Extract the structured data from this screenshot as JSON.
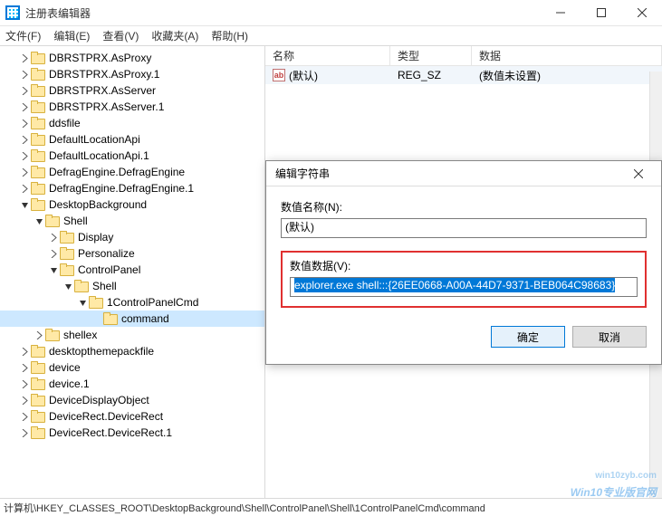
{
  "window": {
    "title": "注册表编辑器",
    "buttons": {
      "min": "minimize",
      "max": "maximize",
      "close": "close"
    }
  },
  "menu": {
    "file": "文件(F)",
    "edit": "编辑(E)",
    "view": "查看(V)",
    "favorites": "收藏夹(A)",
    "help": "帮助(H)"
  },
  "tree": [
    {
      "depth": 1,
      "expand": "closed",
      "label": "DBRSTPRX.AsProxy"
    },
    {
      "depth": 1,
      "expand": "closed",
      "label": "DBRSTPRX.AsProxy.1"
    },
    {
      "depth": 1,
      "expand": "closed",
      "label": "DBRSTPRX.AsServer"
    },
    {
      "depth": 1,
      "expand": "closed",
      "label": "DBRSTPRX.AsServer.1"
    },
    {
      "depth": 1,
      "expand": "closed",
      "label": "ddsfile"
    },
    {
      "depth": 1,
      "expand": "closed",
      "label": "DefaultLocationApi"
    },
    {
      "depth": 1,
      "expand": "closed",
      "label": "DefaultLocationApi.1"
    },
    {
      "depth": 1,
      "expand": "closed",
      "label": "DefragEngine.DefragEngine"
    },
    {
      "depth": 1,
      "expand": "closed",
      "label": "DefragEngine.DefragEngine.1"
    },
    {
      "depth": 1,
      "expand": "open",
      "label": "DesktopBackground"
    },
    {
      "depth": 2,
      "expand": "open",
      "label": "Shell"
    },
    {
      "depth": 3,
      "expand": "closed",
      "label": "Display"
    },
    {
      "depth": 3,
      "expand": "closed",
      "label": "Personalize"
    },
    {
      "depth": 3,
      "expand": "open",
      "label": "ControlPanel"
    },
    {
      "depth": 4,
      "expand": "open",
      "label": "Shell"
    },
    {
      "depth": 5,
      "expand": "open",
      "label": "1ControlPanelCmd"
    },
    {
      "depth": 6,
      "expand": "none",
      "label": "command",
      "selected": true
    },
    {
      "depth": 2,
      "expand": "closed",
      "label": "shellex"
    },
    {
      "depth": 1,
      "expand": "closed",
      "label": "desktopthemepackfile"
    },
    {
      "depth": 1,
      "expand": "closed",
      "label": "device"
    },
    {
      "depth": 1,
      "expand": "closed",
      "label": "device.1"
    },
    {
      "depth": 1,
      "expand": "closed",
      "label": "DeviceDisplayObject"
    },
    {
      "depth": 1,
      "expand": "closed",
      "label": "DeviceRect.DeviceRect"
    },
    {
      "depth": 1,
      "expand": "closed",
      "label": "DeviceRect.DeviceRect.1"
    }
  ],
  "list": {
    "columns": {
      "name": "名称",
      "type": "类型",
      "data": "数据"
    },
    "rows": [
      {
        "icon": "ab",
        "name": "(默认)",
        "type": "REG_SZ",
        "data": "(数值未设置)"
      }
    ]
  },
  "dialog": {
    "title": "编辑字符串",
    "name_label": "数值名称(N):",
    "name_value": "(默认)",
    "data_label": "数值数据(V):",
    "data_value": "explorer.exe shell:::{26EE0668-A00A-44D7-9371-BEB064C98683}",
    "ok": "确定",
    "cancel": "取消"
  },
  "statusbar": "计算机\\HKEY_CLASSES_ROOT\\DesktopBackground\\Shell\\ControlPanel\\Shell\\1ControlPanelCmd\\command",
  "watermark": {
    "main": "Win10专业版官网",
    "sub": "win10zyb.com"
  }
}
